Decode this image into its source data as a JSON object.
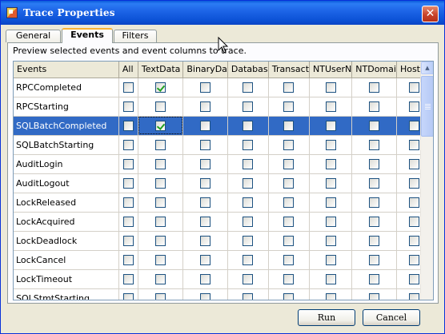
{
  "window": {
    "title": "Trace Properties",
    "close_glyph": "✕"
  },
  "tabs": [
    {
      "label": "General"
    },
    {
      "label": "Events"
    },
    {
      "label": "Filters"
    }
  ],
  "hint": "Preview selected events and event columns to trace.",
  "table": {
    "headers": [
      "Events",
      "All",
      "TextData",
      "BinaryDa",
      "Databas",
      "Transact",
      "NTUserN",
      "NTDomai",
      "HostNa"
    ],
    "rows": [
      {
        "name": "RPCCompleted",
        "checked": [
          false,
          true,
          false,
          false,
          false,
          false,
          false,
          false
        ]
      },
      {
        "name": "RPCStarting",
        "checked": [
          false,
          false,
          false,
          false,
          false,
          false,
          false,
          false
        ]
      },
      {
        "name": "SQLBatchCompleted",
        "checked": [
          false,
          true,
          false,
          false,
          false,
          false,
          false,
          false
        ],
        "selected": true
      },
      {
        "name": "SQLBatchStarting",
        "checked": [
          false,
          false,
          false,
          false,
          false,
          false,
          false,
          false
        ]
      },
      {
        "name": "AuditLogin",
        "checked": [
          false,
          false,
          false,
          false,
          false,
          false,
          false,
          false
        ]
      },
      {
        "name": "AuditLogout",
        "checked": [
          false,
          false,
          false,
          false,
          false,
          false,
          false,
          false
        ]
      },
      {
        "name": "LockReleased",
        "checked": [
          false,
          false,
          false,
          false,
          false,
          false,
          false,
          false
        ]
      },
      {
        "name": "LockAcquired",
        "checked": [
          false,
          false,
          false,
          false,
          false,
          false,
          false,
          false
        ]
      },
      {
        "name": "LockDeadlock",
        "checked": [
          false,
          false,
          false,
          false,
          false,
          false,
          false,
          false
        ]
      },
      {
        "name": "LockCancel",
        "checked": [
          false,
          false,
          false,
          false,
          false,
          false,
          false,
          false
        ]
      },
      {
        "name": "LockTimeout",
        "checked": [
          false,
          false,
          false,
          false,
          false,
          false,
          false,
          false
        ]
      },
      {
        "name": "SQLStmtStarting",
        "checked": [
          false,
          false,
          false,
          false,
          false,
          false,
          false,
          false
        ]
      }
    ]
  },
  "buttons": {
    "run": "Run",
    "cancel": "Cancel"
  },
  "scrollbar": {
    "up_glyph": "▲",
    "position": 0.0
  }
}
